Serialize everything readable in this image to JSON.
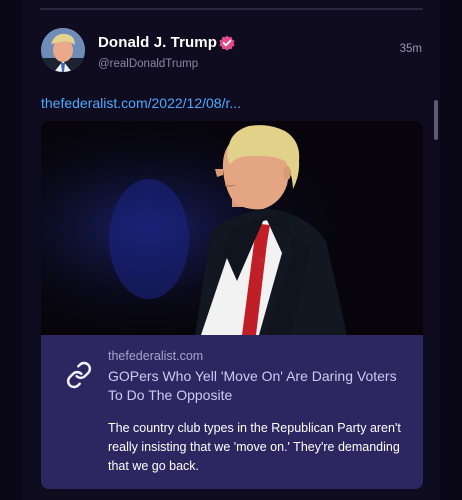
{
  "post": {
    "author_name": "Donald J. Trump",
    "author_handle": "@realDonaldTrump",
    "timestamp": "35m",
    "link_text": "thefederalist.com/2022/12/08/r...",
    "avatar_icon": "profile-photo",
    "verified_icon": "verified-check-icon"
  },
  "link_card": {
    "domain": "thefederalist.com",
    "headline": "GOPers Who Yell 'Move On' Are Daring Voters To Do The Opposite",
    "description": "The country club types in the Republican Party aren't really insisting that we 'move on.' They're demanding that we go back.",
    "icon": "link-icon"
  },
  "colors": {
    "background": "#0f0c1f",
    "link": "#4ea8ff",
    "verified_badge": "#e44a8a",
    "card_background": "#2d2660"
  }
}
